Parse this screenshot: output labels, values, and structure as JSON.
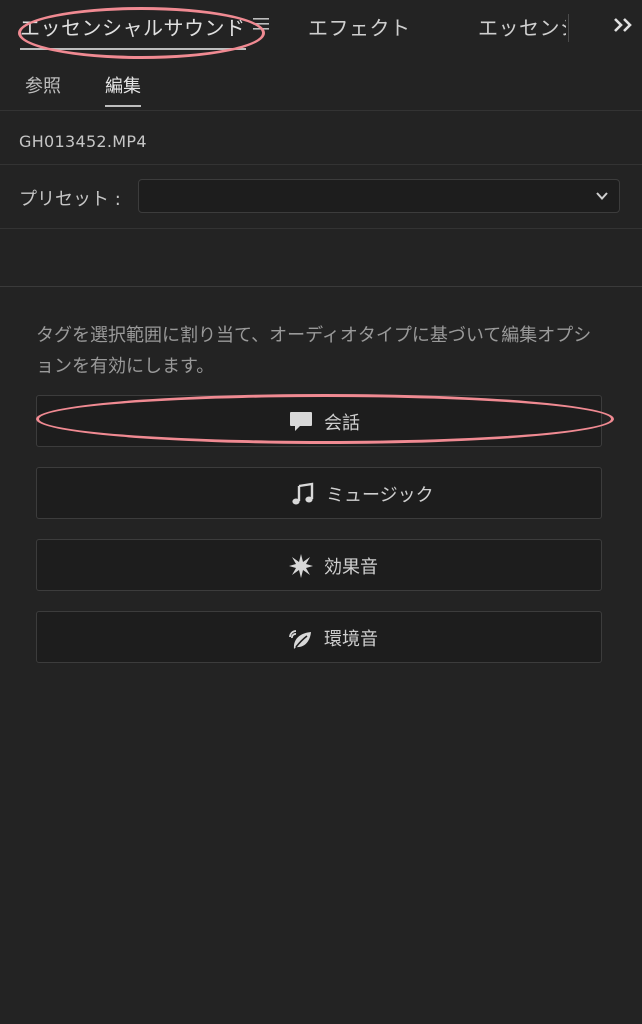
{
  "panel_tabs": {
    "essential_sound": "エッセンシャルサウンド",
    "effects": "エフェクト",
    "essential_truncated": "エッセンシ"
  },
  "sub_tabs": {
    "browse": "参照",
    "edit": "編集"
  },
  "clip": {
    "name": "GH013452.MP4"
  },
  "preset": {
    "label": "プリセット :",
    "value": ""
  },
  "description": "タグを選択範囲に割り当て、オーディオタイプに基づいて編集オプションを有効にします。",
  "tags": [
    {
      "label": "会話",
      "icon": "speech-bubble-icon"
    },
    {
      "label": "ミュージック",
      "icon": "music-note-icon"
    },
    {
      "label": "効果音",
      "icon": "burst-icon"
    },
    {
      "label": "環境音",
      "icon": "ambience-leaf-icon"
    }
  ],
  "colors": {
    "background": "#232323",
    "annotation": "#f08a92"
  }
}
